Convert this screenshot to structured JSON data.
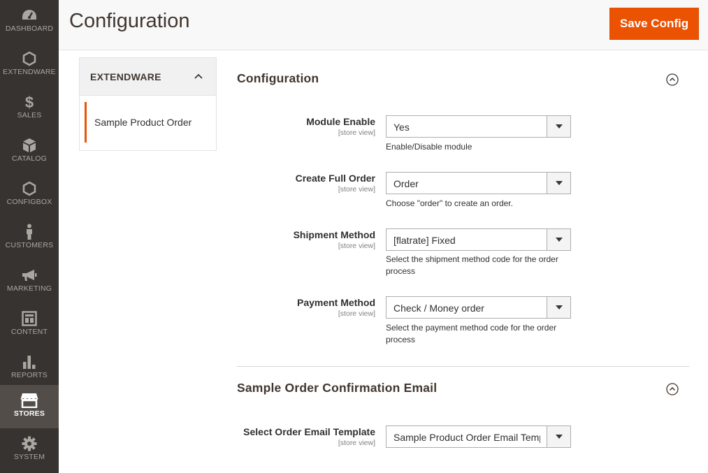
{
  "sidebar": {
    "items": [
      {
        "label": "DASHBOARD",
        "icon": "dashboard-icon"
      },
      {
        "label": "EXTENDWARE",
        "icon": "hexagon-icon"
      },
      {
        "label": "SALES",
        "icon": "dollar-icon"
      },
      {
        "label": "CATALOG",
        "icon": "cube-icon"
      },
      {
        "label": "CONFIGBOX",
        "icon": "hexagon-icon"
      },
      {
        "label": "CUSTOMERS",
        "icon": "person-icon"
      },
      {
        "label": "MARKETING",
        "icon": "megaphone-icon"
      },
      {
        "label": "CONTENT",
        "icon": "layout-icon"
      },
      {
        "label": "REPORTS",
        "icon": "bar-chart-icon"
      },
      {
        "label": "STORES",
        "icon": "store-icon",
        "active": true
      },
      {
        "label": "SYSTEM",
        "icon": "gear-icon"
      }
    ]
  },
  "header": {
    "title": "Configuration",
    "save_label": "Save Config"
  },
  "tabs": {
    "group_title": "EXTENDWARE",
    "items": [
      {
        "label": "Sample Product Order",
        "active": true
      }
    ]
  },
  "sections": [
    {
      "title": "Configuration",
      "fields": [
        {
          "label": "Module Enable",
          "scope": "[store view]",
          "value": "Yes",
          "note": "Enable/Disable module"
        },
        {
          "label": "Create Full Order",
          "scope": "[store view]",
          "value": "Order",
          "note": "Choose \"order\" to create an order."
        },
        {
          "label": "Shipment Method",
          "scope": "[store view]",
          "value": "[flatrate] Fixed",
          "note": "Select the shipment method code for the order process"
        },
        {
          "label": "Payment Method",
          "scope": "[store view]",
          "value": "Check / Money order",
          "note": "Select the payment method code for the order process"
        }
      ]
    },
    {
      "title": "Sample Order Confirmation Email",
      "fields": [
        {
          "label": "Select Order Email Template",
          "scope": "[store view]",
          "value": "Sample Product Order Email Template"
        }
      ]
    }
  ],
  "colors": {
    "sidebar_bg": "#373330",
    "sidebar_active": "#524d49",
    "accent": "#eb5202"
  }
}
